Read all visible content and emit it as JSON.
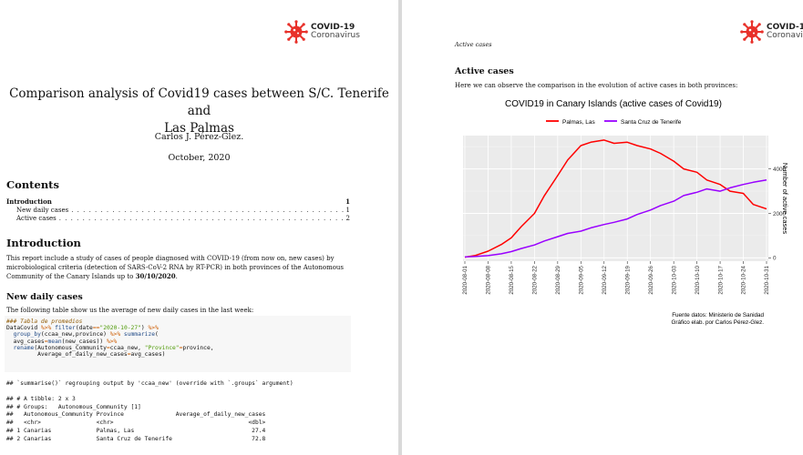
{
  "logo": {
    "line1": "COVID-19",
    "line2": "Coronavirus",
    "virus_color": "#e8312a"
  },
  "left_page": {
    "title_line1": "Comparison analysis of Covid19 cases between S/C. Tenerife and",
    "title_line2": "Las Palmas",
    "author": "Carlos J. Pérez-Glez.",
    "date": "October, 2020",
    "contents_heading": "Contents",
    "toc": [
      {
        "label": "Introduction",
        "page": "1"
      },
      {
        "label": "New daily cases",
        "page": "1"
      },
      {
        "label": "Active cases",
        "page": "2"
      }
    ],
    "intro_heading": "Introduction",
    "intro_text": "This report include a study of cases of people diagnosed with COVID-19 (from now on, new cases) by microbiological criteria (detection of SARS-CoV-2 RNA by RT-PCR) in both provinces of the Autonomous Community of the Canary Islands up to ",
    "intro_date": "30/10/2020",
    "intro_end": ".",
    "new_cases_heading": "New daily cases",
    "new_cases_text": "The following table show us the average of new daily cases in the last week:",
    "code": {
      "comment": "### Tabla de promedios",
      "line2_a": "DataCovid ",
      "line2_op1": "%>%",
      "line2_fn": " filter",
      "line2_b": "(date",
      "line2_op2": "==",
      "line2_str": "\"2020-10-27\"",
      "line2_c": ") ",
      "line2_op3": "%>%",
      "line3_fn1": "  group_by",
      "line3_a": "(ccaa_new,province) ",
      "line3_op1": "%>%",
      "line3_fn2": " summarize",
      "line3_b": "(",
      "line4_a": "  avg_cases",
      "line4_op": "=",
      "line4_fn": "mean",
      "line4_b": "(new_cases)) ",
      "line4_op2": "%>%",
      "line5_fn": "  rename",
      "line5_a": "(Autonomous_Community",
      "line5_op1": "=",
      "line5_b": "ccaa_new, ",
      "line5_str": "\"Province\"",
      "line5_op2": "=",
      "line5_c": "province,",
      "line6_a": "         Average_of_daily_new_cases",
      "line6_op": "=",
      "line6_b": "avg_cases)"
    },
    "message": "## `summarise()` regrouping output by 'ccaa_new' (override with `.groups` argument)",
    "output": {
      "line1": "## # A tibble: 2 x 3",
      "line2": "## # Groups:   Autonomous_Community [1]",
      "header": "##   Autonomous_Community Province               Average_of_daily_new_cases",
      "types": "##   <chr>                <chr>                                       <dbl>",
      "row1": "## 1 Canarias             Palmas, Las                                  27.4",
      "row2": "## 2 Canarias             Santa Cruz de Tenerife                       72.8"
    }
  },
  "right_page": {
    "running_header": "Active cases",
    "heading": "Active cases",
    "intro_text": "Here we can observe the comparison in the evolution of active cases in both provinces:",
    "caption_line1": "Fuente datos: Ministerio de Sanidad",
    "caption_line2": "Gráfico elab. por Carlos Pérez-Glez."
  },
  "chart_data": {
    "type": "line",
    "title": "COVID19 in Canary Islands (active cases of Covid19)",
    "xlabel": "",
    "ylabel": "Number of active cases",
    "y_axis_side": "right",
    "ylim": [
      -150,
      5500
    ],
    "yticks": [
      0,
      2000,
      4000
    ],
    "grid": true,
    "legend_position": "top",
    "x": [
      "2020-08-01",
      "2020-08-04",
      "2020-08-08",
      "2020-08-12",
      "2020-08-15",
      "2020-08-18",
      "2020-08-22",
      "2020-08-25",
      "2020-08-29",
      "2020-09-01",
      "2020-09-05",
      "2020-09-08",
      "2020-09-12",
      "2020-09-15",
      "2020-09-19",
      "2020-09-22",
      "2020-09-26",
      "2020-09-29",
      "2020-10-03",
      "2020-10-06",
      "2020-10-10",
      "2020-10-13",
      "2020-10-17",
      "2020-10-20",
      "2020-10-24",
      "2020-10-27",
      "2020-10-31"
    ],
    "x_ticks": [
      "2020-08-01",
      "2020-08-08",
      "2020-08-15",
      "2020-08-22",
      "2020-08-29",
      "2020-09-05",
      "2020-09-12",
      "2020-09-19",
      "2020-09-26",
      "2020-10-03",
      "2020-10-10",
      "2020-10-17",
      "2020-10-24",
      "2020-10-31"
    ],
    "series": [
      {
        "name": "Palmas, Las",
        "color": "#ff0000",
        "values": [
          30,
          100,
          300,
          600,
          900,
          1400,
          2000,
          2800,
          3700,
          4400,
          5050,
          5200,
          5300,
          5150,
          5200,
          5050,
          4900,
          4700,
          4350,
          4000,
          3850,
          3500,
          3300,
          3000,
          2900,
          2400,
          2200
        ]
      },
      {
        "name": "Santa Cruz de Tenerife",
        "color": "#9900ff",
        "values": [
          40,
          60,
          100,
          180,
          280,
          420,
          580,
          760,
          950,
          1100,
          1200,
          1350,
          1500,
          1600,
          1750,
          1950,
          2150,
          2350,
          2550,
          2800,
          2950,
          3100,
          3000,
          3150,
          3300,
          3400,
          3500
        ]
      }
    ]
  }
}
